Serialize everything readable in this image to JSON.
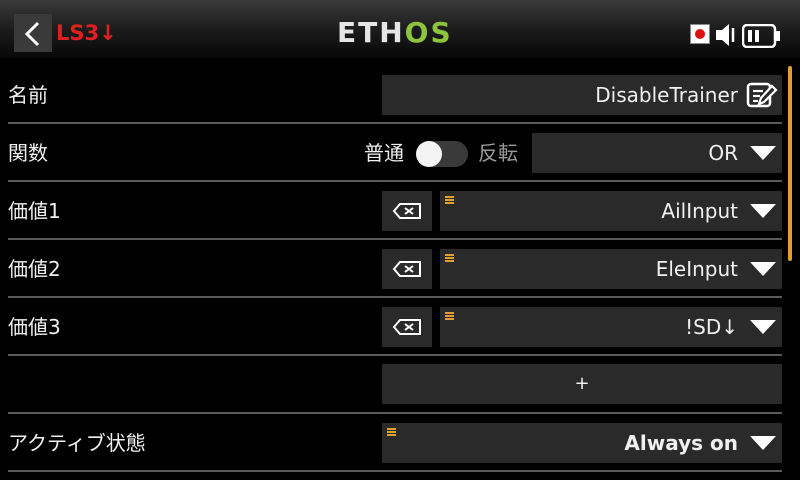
{
  "header": {
    "title": "LS3↓",
    "logo_main": "ETH",
    "logo_accent": "OS"
  },
  "rows": {
    "name": {
      "label": "名前",
      "value": "DisableTrainer"
    },
    "function": {
      "label": "関数",
      "toggle_off_label": "普通",
      "toggle_on_label": "反転",
      "toggle_state": "off",
      "value": "OR"
    },
    "value1": {
      "label": "価値1",
      "value": "AilInput"
    },
    "value2": {
      "label": "価値2",
      "value": "EleInput"
    },
    "value3": {
      "label": "価値3",
      "value": "!SD↓"
    },
    "add": {
      "label": "+"
    },
    "active": {
      "label": "アクティブ状態",
      "value": "Always on"
    }
  },
  "colors": {
    "title_red": "#e02020",
    "logo_green": "#8cc43c",
    "accent_orange": "#e0a030",
    "field_bg": "#2a2a2a"
  },
  "icons": {
    "back": "chevron-left-icon",
    "record": "record-icon",
    "audio": "speaker-icon",
    "battery": "battery-icon",
    "edit": "edit-icon",
    "clear": "clear-icon",
    "dropdown": "triangle-down-icon"
  }
}
